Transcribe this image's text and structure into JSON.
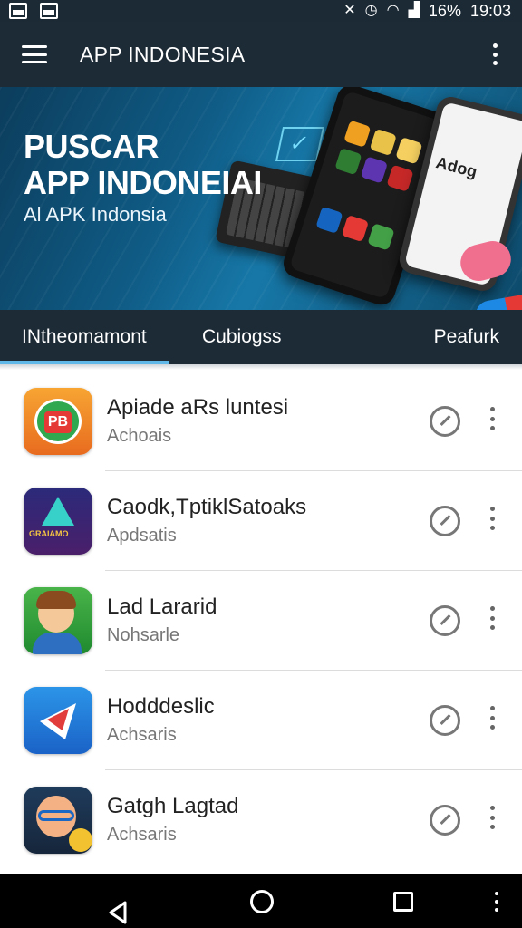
{
  "status_bar": {
    "battery": "16%",
    "time": "19:03",
    "icons": [
      "photo-notification-icon",
      "gallery-notification-icon",
      "mute-icon",
      "alarm-icon",
      "wifi-icon",
      "signal-icon"
    ]
  },
  "app_bar": {
    "title": "APP INDONESIA"
  },
  "banner": {
    "title_line1": "PUSCAR",
    "title_line2": "APP INDONEIAI",
    "subtitle": "Al APK Indonsia",
    "phone_text": "Adog"
  },
  "tabs": [
    {
      "label": "INtheomamont",
      "selected": true
    },
    {
      "label": "Cubiogss",
      "selected": false
    },
    {
      "label": "Peafurk",
      "selected": false
    }
  ],
  "apps": [
    {
      "name": "Apiade aRs luntesi",
      "category": "Achoais",
      "icon": "app-icon-pb-badge"
    },
    {
      "name": "Caodk,TptiklSatoaks",
      "category": "Apdsatis",
      "icon": "app-icon-triangle-logo",
      "icon_label": "GRAIAMO"
    },
    {
      "name": "Lad Lararid",
      "category": "Nohsarle",
      "icon": "app-icon-cartoon-boy"
    },
    {
      "name": "Hodddeslic",
      "category": "Achsaris",
      "icon": "app-icon-arrow"
    },
    {
      "name": "Gatgh Lagtad",
      "category": "Achsaris",
      "icon": "app-icon-glasses-character"
    }
  ],
  "colors": {
    "app_bar": "#1d2b37",
    "tab_indicator": "#5fb8e8",
    "list_background": "#ffffff"
  }
}
